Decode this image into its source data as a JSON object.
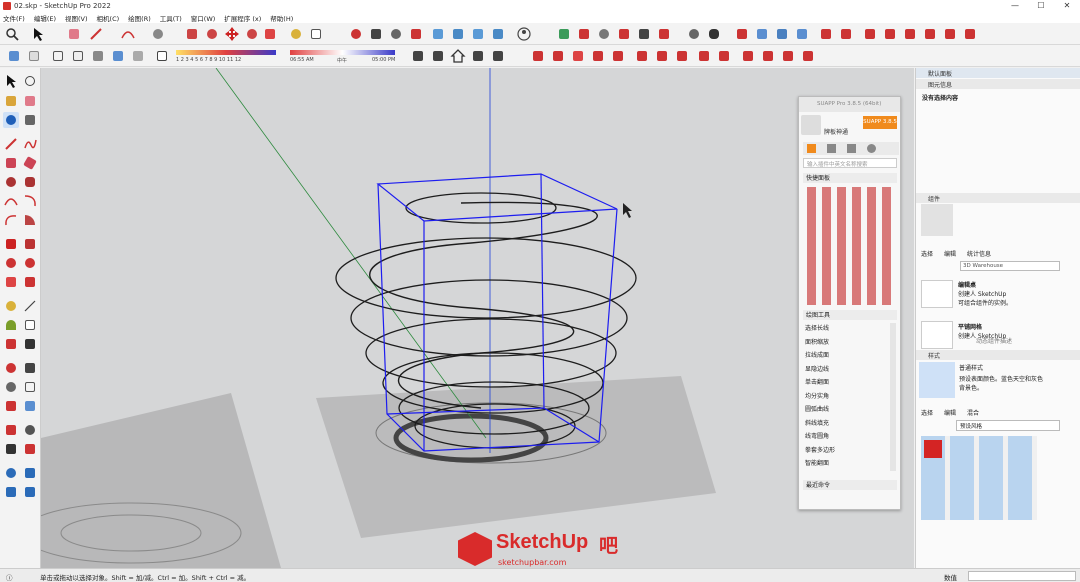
{
  "window": {
    "title": "02.skp - SketchUp Pro 2022",
    "minimize": "—",
    "maximize": "☐",
    "close": "✕"
  },
  "menu": [
    "文件(F)",
    "编辑(E)",
    "视图(V)",
    "相机(C)",
    "绘图(R)",
    "工具(T)",
    "窗口(W)",
    "扩展程序 (x)",
    "帮助(H)"
  ],
  "shadow": {
    "months": "J F M A M J J A S O N D",
    "hours": "1 2 3 4 5 6 7 8 9 10 11 12",
    "time_start": "06:55 AM",
    "time_mid": "中午",
    "time_end": "05:00 PM"
  },
  "suapp": {
    "title": "SUAPP Pro 3.8.5 (64bit)",
    "badge": "SUAPP 3.8.5",
    "user": "牌板神通",
    "search_placeholder": "输入插件中英文名称搜索",
    "quick_panel": "快捷面板",
    "drawing_tools": "绘图工具",
    "tool_items": [
      "选择长线",
      "面积缩放",
      "拉线成面",
      "显隐边线",
      "单击翻面",
      "均分实角",
      "圆弧曲线",
      "斜线填充",
      "线弯圆角",
      "拳套多边形",
      "智能翻面"
    ],
    "recent": "最近命令"
  },
  "tray": {
    "title": "默认面板",
    "entity_info": "图元信息",
    "nothing_selected": "没有选择内容",
    "components": "组件",
    "tabs": [
      "选择",
      "编辑",
      "统计信息"
    ],
    "search_value": "3D Warehouse",
    "comp1_title": "编辑桌",
    "comp1_line1": "创建人 SketchUp",
    "comp1_line2": "可组合组件的实例。",
    "comp2_title": "平铺网格",
    "comp2_line1": "创建人 SketchUp",
    "dynamic_note": "动态组件描述",
    "styles": "样式",
    "style_name": "普通样式",
    "style_desc_1": "预设表面颜色。蓝色天空和灰色",
    "style_desc_2": "背景色。",
    "style_tabs": [
      "选择",
      "编辑",
      "混合"
    ],
    "style_filter": "预设风格"
  },
  "status": {
    "hint": "单击或拖动以选择对象。Shift = 加/减。Ctrl = 加。Shift + Ctrl = 减。",
    "measure_label": "数值"
  },
  "watermark": {
    "brand": "SketchUp",
    "suffix": "吧",
    "url": "sketchupbar.com"
  },
  "colors": {
    "accent": "#1f5fb8",
    "suapp_orange": "#f08a1c",
    "watermark_red": "#d92b2b",
    "selection_blue": "#1d1df0"
  }
}
